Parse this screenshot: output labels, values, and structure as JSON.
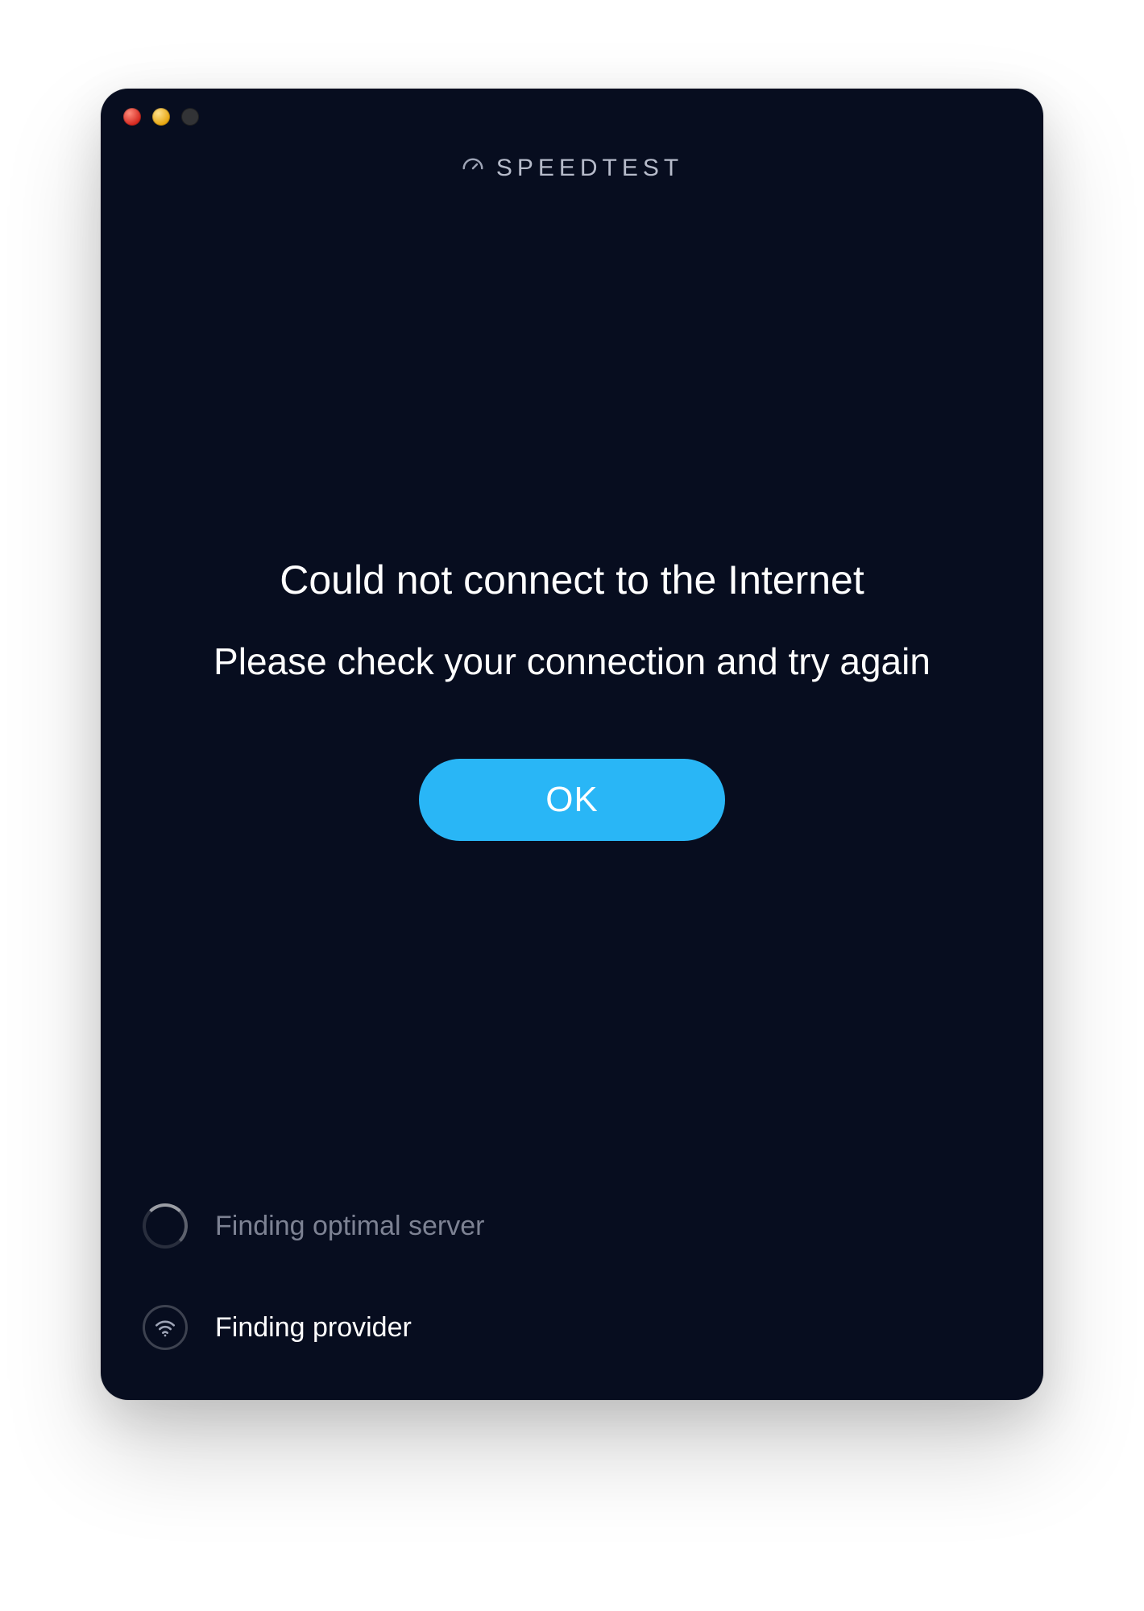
{
  "brand": {
    "name": "SPEEDTEST"
  },
  "error": {
    "headline": "Could not connect to the Internet",
    "subline": "Please check your connection and try again",
    "ok_label": "OK"
  },
  "status": {
    "server": {
      "label": "Finding optimal server"
    },
    "provider": {
      "label": "Finding provider"
    }
  },
  "colors": {
    "accent": "#29b6f6",
    "background": "#070d1f",
    "text_primary": "#ffffff",
    "text_muted": "#7d8293",
    "brand_text": "#b6bbca"
  }
}
